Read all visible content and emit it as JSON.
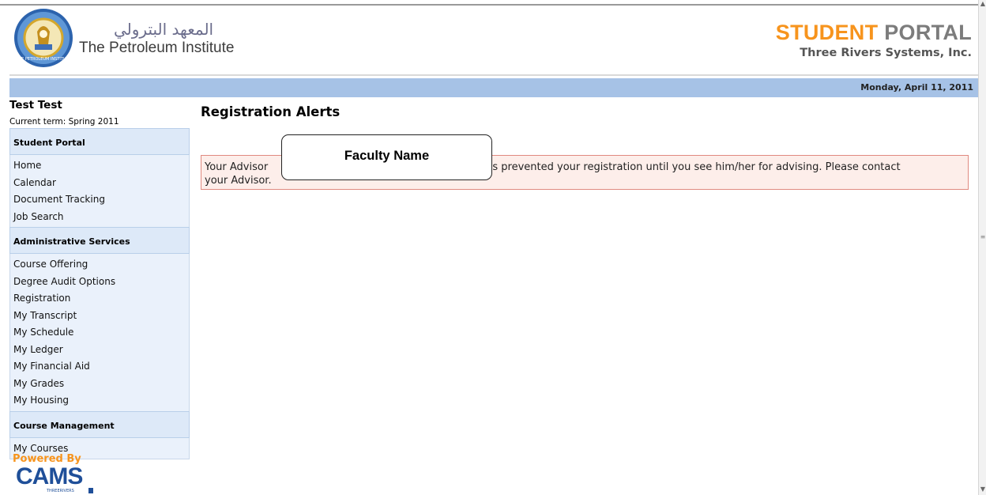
{
  "header": {
    "logo_arabic": "المعهد البترولي",
    "logo_english": "The Petroleum Institute",
    "portal_title_word1": "STUDENT",
    "portal_title_word2": "PORTAL",
    "portal_subtitle": "Three Rivers Systems, Inc.",
    "logo_seal_text": "THE PETROLEUM INSTITUTE",
    "colors": {
      "orange": "#f7941d",
      "gray": "#7c7c7c",
      "date_bar": "#a6c2e6"
    }
  },
  "date_bar": {
    "date": "Monday, April 11, 2011"
  },
  "sidebar": {
    "user_name": "Test Test",
    "term": "Current term: Spring 2011",
    "sections": [
      {
        "title": "Student Portal",
        "items": [
          "Home",
          "Calendar",
          "Document Tracking",
          "Job Search"
        ]
      },
      {
        "title": "Administrative Services",
        "items": [
          "Course Offering",
          "Degree Audit Options",
          "Registration",
          "My Transcript",
          "My Schedule",
          "My Ledger",
          "My Financial Aid",
          "My Grades",
          "My Housing"
        ]
      },
      {
        "title": "Course Management",
        "items": [
          "My Courses"
        ]
      }
    ],
    "powered_by": "Powered By",
    "cams_logo_text": "CAMS",
    "cams_logo_subtext": "THREERIVERS"
  },
  "main": {
    "page_title": "Registration Alerts",
    "alert_prefix": "Your Advisor",
    "alert_suffix": "has prevented your registration until you see him/her for advising. Please contact",
    "alert_line2": "your Advisor.",
    "faculty_callout": "Faculty Name"
  },
  "icons": [
    "petroleum-institute-seal-icon",
    "cams-logo-icon",
    "scroll-up-icon",
    "scroll-down-icon"
  ]
}
